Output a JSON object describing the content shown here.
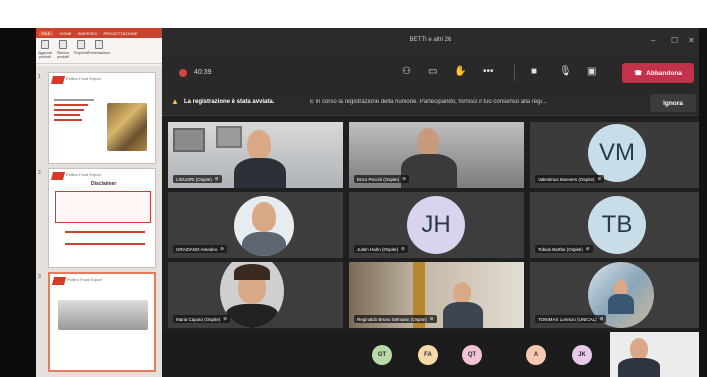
{
  "ppt": {
    "tabs": [
      "FILE",
      "HOME",
      "INSERISCI",
      "PROGETTAZIONE"
    ],
    "ribbon": [
      "Aggiunta prodotti",
      "Ricerca prodotti",
      "Proprietà",
      "Presentazione"
    ],
    "slide_titles": [
      "Disclaimer"
    ],
    "brand": "Pollino Food Export",
    "slide_numbers": [
      "1",
      "2",
      "3"
    ]
  },
  "teams": {
    "window_title": "BETTI e altri 26",
    "timer": "40:39",
    "leave_label": "Abbandona",
    "banner_bold": "La registrazione è stata avviata.",
    "banner_text": "È in corso la registrazione della riunione. Partecipando, fornisci il tuo consenso alla regi...",
    "ignore_label": "Ignora",
    "participants": [
      {
        "name": "LIGUORI (Ospite)",
        "type": "video"
      },
      {
        "name": "Enzo Pecchi (Ospite)",
        "type": "video"
      },
      {
        "name": "Valentinus Moevers (Ospite)",
        "type": "avatar",
        "initials": "VM",
        "color": "#c7dde9"
      },
      {
        "name": "GRAZIANO Amedeo",
        "type": "video"
      },
      {
        "name": "Justin Hahn (Ospite)",
        "type": "avatar",
        "initials": "JH",
        "color": "#d8d3ee"
      },
      {
        "name": "Tobias Barthe (Ospite)",
        "type": "avatar",
        "initials": "TB",
        "color": "#c8dde8"
      },
      {
        "name": "Maria Caputo (Ospite)",
        "type": "video"
      },
      {
        "name": "Reginaldo Bruno Selmann (Ospite)",
        "type": "video"
      },
      {
        "name": "TONIMAX Lorenzo (UNICAL)",
        "type": "video"
      }
    ],
    "bottom_avatars": [
      {
        "initials": "GT",
        "color": "#b8dba6"
      },
      {
        "initials": "FA",
        "color": "#f5d9a8"
      },
      {
        "initials": "QT",
        "color": "#f2c2d6"
      },
      {
        "initials": "A",
        "color": "#f7c8b2"
      },
      {
        "initials": "JK",
        "color": "#e9c8e8"
      }
    ]
  }
}
